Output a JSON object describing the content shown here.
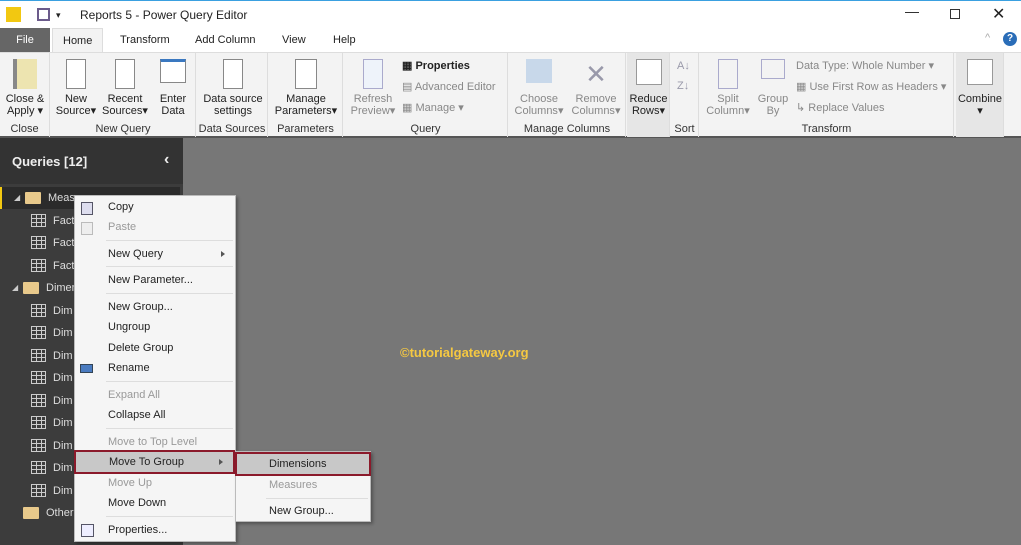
{
  "window": {
    "title": "Reports 5 - Power Query Editor"
  },
  "tabs": [
    "File",
    "Home",
    "Transform",
    "Add Column",
    "View",
    "Help"
  ],
  "ribbon": {
    "close": {
      "close_apply": "Close &",
      "close_apply2": "Apply",
      "label": "Close"
    },
    "new_query": {
      "new_source": "New",
      "new_source2": "Source",
      "recent": "Recent",
      "recent2": "Sources",
      "enter": "Enter",
      "enter2": "Data",
      "label": "New Query"
    },
    "data_sources": {
      "settings": "Data source",
      "settings2": "settings",
      "label": "Data Sources"
    },
    "parameters": {
      "manage": "Manage",
      "manage2": "Parameters",
      "label": "Parameters"
    },
    "query": {
      "refresh": "Refresh",
      "refresh2": "Preview",
      "properties": "Properties",
      "advanced": "Advanced Editor",
      "manage": "Manage",
      "label": "Query"
    },
    "manage_columns": {
      "choose": "Choose",
      "choose2": "Columns",
      "remove": "Remove",
      "remove2": "Columns",
      "label": "Manage Columns"
    },
    "reduce": {
      "reduce": "Reduce",
      "reduce2": "Rows"
    },
    "sort": {
      "label": "Sort"
    },
    "transform": {
      "split": "Split",
      "split2": "Column",
      "group": "Group",
      "group2": "By",
      "data_type": "Data Type: Whole Number",
      "first_row": "Use First Row as Headers",
      "replace": "Replace Values",
      "label": "Transform"
    },
    "combine": {
      "label": "Combine"
    }
  },
  "sidebar": {
    "title": "Queries [12]",
    "items": [
      {
        "t": "Meas",
        "f": 1
      },
      {
        "t": "Fact"
      },
      {
        "t": "Fact"
      },
      {
        "t": "Fact"
      },
      {
        "t": "Dimen",
        "f": 1
      },
      {
        "t": "Dim"
      },
      {
        "t": "Dim"
      },
      {
        "t": "Dim"
      },
      {
        "t": "Dim"
      },
      {
        "t": "Dim"
      },
      {
        "t": "Dim"
      },
      {
        "t": "Dim"
      },
      {
        "t": "Dim"
      },
      {
        "t": "Dim"
      },
      {
        "t": "Other",
        "f": 1
      }
    ]
  },
  "menu": {
    "copy": "Copy",
    "paste": "Paste",
    "new_query": "New Query",
    "new_parameter": "New Parameter...",
    "new_group": "New Group...",
    "ungroup": "Ungroup",
    "delete_group": "Delete Group",
    "rename": "Rename",
    "expand_all": "Expand All",
    "collapse_all": "Collapse All",
    "move_top": "Move to Top Level",
    "move_to_group": "Move To Group",
    "move_up": "Move Up",
    "move_down": "Move Down",
    "properties": "Properties..."
  },
  "submenu": {
    "dimensions": "Dimensions",
    "measures": "Measures",
    "new_group": "New Group..."
  },
  "watermark": "©tutorialgateway.org"
}
